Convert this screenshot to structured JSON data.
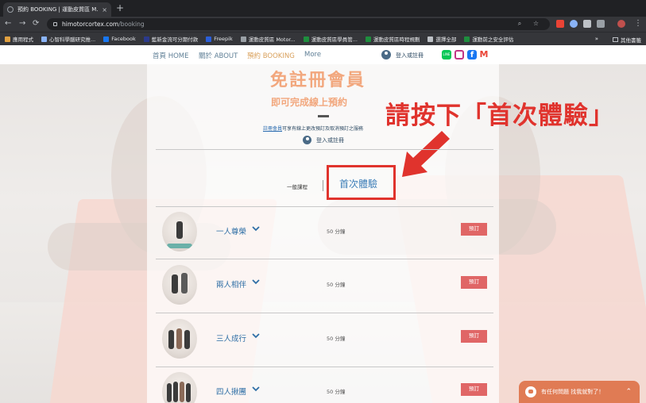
{
  "browser": {
    "tab_title": "預約 BOOKING | 運動皮質區 M...",
    "tab_close": "×",
    "new_tab": "+",
    "back": "←",
    "forward": "→",
    "reload": "⟳",
    "url_host": "himotorcortex.com",
    "url_path": "/booking",
    "omnibox_icons": "⌕ ☆",
    "menu": "⋮",
    "bookmarks": [
      {
        "label": "應用程式",
        "color": "#e0a040"
      },
      {
        "label": "心智科學腦研究推...",
        "color": "#8ab4f8"
      },
      {
        "label": "Facebook",
        "color": "#1877f2"
      },
      {
        "label": "藍新金流可分期付款",
        "color": "#2b3a8c"
      },
      {
        "label": "Freepik",
        "color": "#2b5fd9"
      },
      {
        "label": "運動皮質區 Motor...",
        "color": "#9aa0a6"
      },
      {
        "label": "運動皮質區學員管...",
        "color": "#1e8e3e"
      },
      {
        "label": "運動皮質區時程規劃",
        "color": "#1e8e3e"
      },
      {
        "label": "選擇全部",
        "color": "#bdc1c6"
      },
      {
        "label": "運動前之安全評估",
        "color": "#1e8e3e"
      }
    ],
    "bookmarks_more": "»",
    "bookmarks_other": "其他書籤"
  },
  "site_nav": {
    "home": "首頁 HOME",
    "about": "關於 ABOUT",
    "booking": "預約 BOOKING",
    "more": "More",
    "login": "登入或註冊"
  },
  "social": [
    {
      "name": "line",
      "color": "#06c755",
      "label": "LINE"
    },
    {
      "name": "instagram",
      "color": "#c13584",
      "label": ""
    },
    {
      "name": "facebook",
      "color": "#1877f2",
      "label": "f"
    },
    {
      "name": "gmail",
      "color": "#ea4335",
      "label": "M"
    }
  ],
  "hero": {
    "line1": "免註冊會員",
    "line2": "即可完成線上預約",
    "note_link": "註冊會員",
    "note_rest": "可享有線上更改預訂及取消預訂之服務",
    "login": "登入或註冊"
  },
  "callout": "請按下「首次體驗」",
  "tabs": {
    "general": "一般課程",
    "trial": "首次體驗"
  },
  "services": [
    {
      "name": "一人尊榮",
      "duration": "50 分鐘",
      "button": "預訂"
    },
    {
      "name": "兩人相伴",
      "duration": "50 分鐘",
      "button": "預訂"
    },
    {
      "name": "三人成行",
      "duration": "50 分鐘",
      "button": "預訂"
    },
    {
      "name": "四人揪團",
      "duration": "50 分鐘",
      "button": "預訂"
    }
  ],
  "chat": {
    "text": "有任何問題 找我就對了！",
    "chevron": "⌃"
  }
}
